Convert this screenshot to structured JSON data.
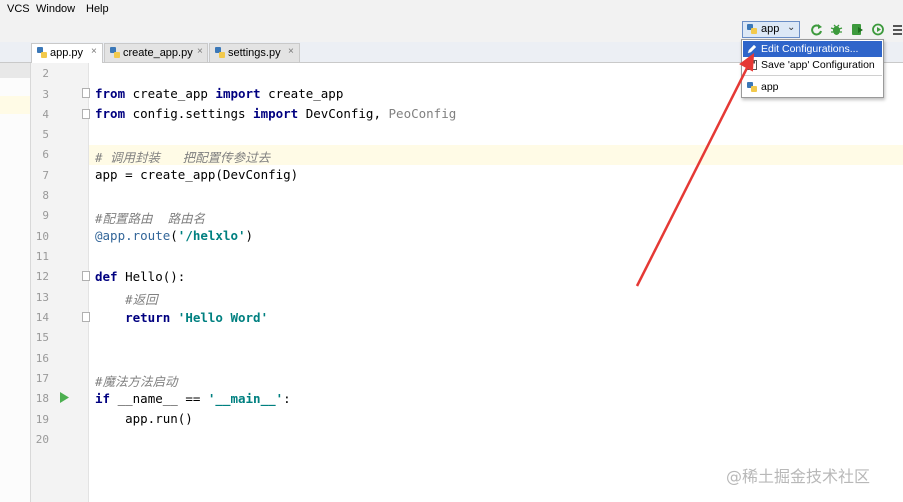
{
  "menubar": {
    "items": [
      "VCS",
      "Window",
      "Help"
    ]
  },
  "toolbar": {
    "run_config_label": "app",
    "run_config_icon": "python-config-icon",
    "icons": [
      "rerun-icon",
      "debug-icon",
      "coverage-icon",
      "profile-icon",
      "more-icon"
    ]
  },
  "tabs": [
    {
      "label": "app.py",
      "active": true
    },
    {
      "label": "create_app.py",
      "active": false
    },
    {
      "label": "settings.py",
      "active": false
    }
  ],
  "tab_close_glyph": "×",
  "editor": {
    "lines": [
      {
        "num": "2",
        "text": ""
      },
      {
        "num": "3",
        "text": "from create_app import create_app"
      },
      {
        "num": "4",
        "text": "from config.settings import DevConfig, PeoConfig"
      },
      {
        "num": "5",
        "text": ""
      },
      {
        "num": "6",
        "text": "# 调用封装   把配置传参过去"
      },
      {
        "num": "7",
        "text": "app = create_app(DevConfig)"
      },
      {
        "num": "8",
        "text": ""
      },
      {
        "num": "9",
        "text": "#配置路由  路由名"
      },
      {
        "num": "10",
        "text": "@app.route('/helxlo')"
      },
      {
        "num": "11",
        "text": ""
      },
      {
        "num": "12",
        "text": "def Hello():"
      },
      {
        "num": "13",
        "text": "    #返回"
      },
      {
        "num": "14",
        "text": "    return 'Hello Word'"
      },
      {
        "num": "15",
        "text": ""
      },
      {
        "num": "16",
        "text": ""
      },
      {
        "num": "17",
        "text": "#魔法方法启动"
      },
      {
        "num": "18",
        "text": "if __name__ == '__main__':"
      },
      {
        "num": "19",
        "text": "    app.run()"
      },
      {
        "num": "20",
        "text": ""
      }
    ]
  },
  "popup": {
    "items": [
      {
        "label": "Edit Configurations...",
        "selected": true,
        "icon": "edit-config-icon"
      },
      {
        "label": "Save 'app' Configuration",
        "selected": false,
        "icon": "save-icon"
      },
      {
        "label": "app",
        "selected": false,
        "icon": "python-config-icon"
      }
    ]
  },
  "watermark": "@稀土掘金技术社区",
  "colors": {
    "keyword": "#000080",
    "comment": "#808080",
    "string": "#008080",
    "selection": "#2f65ca",
    "arrow": "#e53935",
    "run_icon": "#4caf50"
  }
}
